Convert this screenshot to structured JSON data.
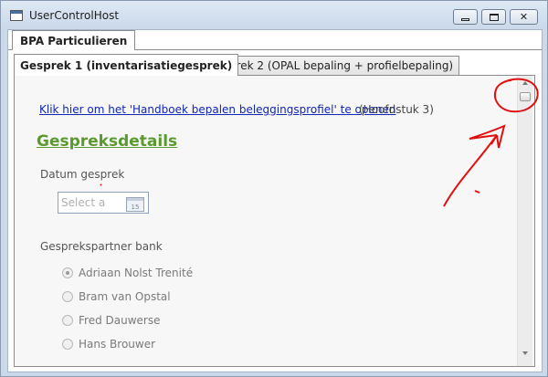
{
  "window": {
    "title": "UserControlHost"
  },
  "outer_tab": {
    "label": "BPA Particulieren"
  },
  "inner_tabs": [
    {
      "label": "Gesprek 1 (inventarisatiegesprek)",
      "active": true
    },
    {
      "label": "Gesprek 2 (OPAL bepaling + profielbepaling)",
      "active": false
    }
  ],
  "content": {
    "handbook_link": "Klik hier om het 'Handboek bepalen beleggingsprofiel' te openen",
    "handbook_suffix": "(Hoofdstuk 3)",
    "section_heading": "Gespreksdetails",
    "date_label": "Datum gesprek",
    "date_placeholder": "Select a",
    "calendar_day": "15",
    "partner_label": "Gesprekspartner bank",
    "partners": [
      {
        "label": "Adriaan Nolst Trenité",
        "selected": true
      },
      {
        "label": "Bram van Opstal",
        "selected": false
      },
      {
        "label": "Fred Dauwerse",
        "selected": false
      },
      {
        "label": "Hans Brouwer",
        "selected": false
      }
    ]
  },
  "colors": {
    "link": "#0f26b8",
    "heading": "#5a9a2f",
    "annotation": "#e01010"
  },
  "icons": {
    "app": "window-app-icon",
    "minimize": "minimize-icon",
    "maximize": "maximize-icon",
    "close": "close-icon",
    "calendar": "calendar-icon"
  }
}
